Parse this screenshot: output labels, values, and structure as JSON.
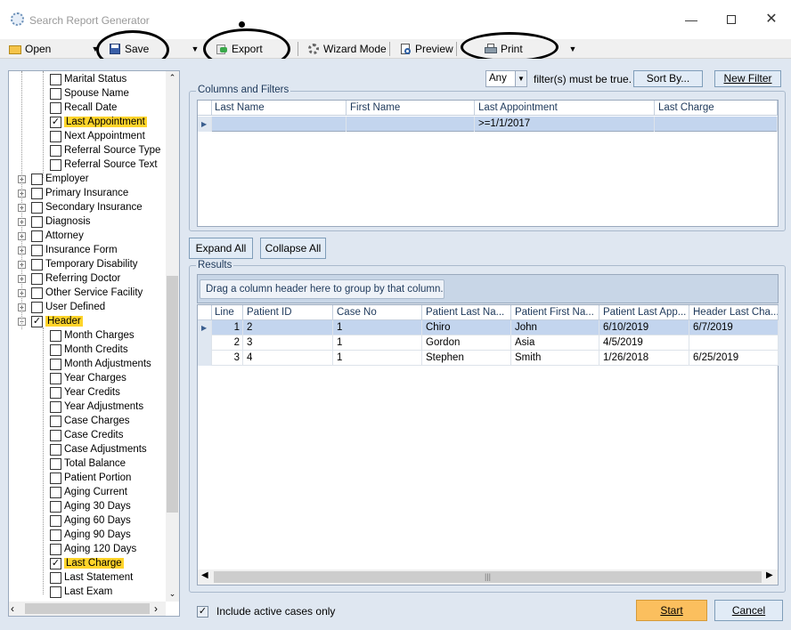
{
  "window": {
    "title": "Search Report Generator"
  },
  "toolbar": {
    "open": "Open",
    "save": "Save",
    "export": "Export",
    "wizard": "Wizard Mode",
    "preview": "Preview",
    "print": "Print"
  },
  "tree": {
    "items": [
      {
        "label": "Marital Status",
        "checked": false,
        "highlight": false
      },
      {
        "label": "Spouse Name",
        "checked": false,
        "highlight": false
      },
      {
        "label": "Recall Date",
        "checked": false,
        "highlight": false
      },
      {
        "label": "Last Appointment",
        "checked": true,
        "highlight": true
      },
      {
        "label": "Next Appointment",
        "checked": false,
        "highlight": false
      },
      {
        "label": "Referral Source Type",
        "checked": false,
        "highlight": false
      },
      {
        "label": "Referral Source Text",
        "checked": false,
        "highlight": false
      },
      {
        "label": "Employer",
        "checked": false,
        "highlight": false
      },
      {
        "label": "Primary Insurance",
        "checked": false,
        "highlight": false
      },
      {
        "label": "Secondary Insurance",
        "checked": false,
        "highlight": false
      },
      {
        "label": "Diagnosis",
        "checked": false,
        "highlight": false
      },
      {
        "label": "Attorney",
        "checked": false,
        "highlight": false
      },
      {
        "label": "Insurance Form",
        "checked": false,
        "highlight": false
      },
      {
        "label": "Temporary Disability",
        "checked": false,
        "highlight": false
      },
      {
        "label": "Referring Doctor",
        "checked": false,
        "highlight": false
      },
      {
        "label": "Other Service Facility",
        "checked": false,
        "highlight": false
      },
      {
        "label": "User Defined",
        "checked": false,
        "highlight": false
      },
      {
        "label": "Header",
        "checked": true,
        "highlight": true
      },
      {
        "label": "Month Charges",
        "checked": false,
        "highlight": false
      },
      {
        "label": "Month Credits",
        "checked": false,
        "highlight": false
      },
      {
        "label": "Month Adjustments",
        "checked": false,
        "highlight": false
      },
      {
        "label": "Year Charges",
        "checked": false,
        "highlight": false
      },
      {
        "label": "Year Credits",
        "checked": false,
        "highlight": false
      },
      {
        "label": "Year Adjustments",
        "checked": false,
        "highlight": false
      },
      {
        "label": "Case Charges",
        "checked": false,
        "highlight": false
      },
      {
        "label": "Case Credits",
        "checked": false,
        "highlight": false
      },
      {
        "label": "Case Adjustments",
        "checked": false,
        "highlight": false
      },
      {
        "label": "Total Balance",
        "checked": false,
        "highlight": false
      },
      {
        "label": "Patient Portion",
        "checked": false,
        "highlight": false
      },
      {
        "label": "Aging Current",
        "checked": false,
        "highlight": false
      },
      {
        "label": "Aging 30 Days",
        "checked": false,
        "highlight": false
      },
      {
        "label": "Aging 60 Days",
        "checked": false,
        "highlight": false
      },
      {
        "label": "Aging 90 Days",
        "checked": false,
        "highlight": false
      },
      {
        "label": "Aging 120 Days",
        "checked": false,
        "highlight": false
      },
      {
        "label": "Last Charge",
        "checked": true,
        "highlight": true
      },
      {
        "label": "Last Statement",
        "checked": false,
        "highlight": false
      },
      {
        "label": "Last Exam",
        "checked": false,
        "highlight": false
      }
    ]
  },
  "filter": {
    "mode": "Any",
    "text": "filter(s) must be true.",
    "sort_by": "Sort By...",
    "new_filter": "New Filter"
  },
  "columns": {
    "group_label": "Columns and Filters",
    "headers": [
      "Last Name",
      "First Name",
      "Last Appointment",
      "Last Charge"
    ],
    "filter_row": [
      "",
      "",
      ">=1/1/2017",
      ""
    ]
  },
  "buttons": {
    "expand_all": "Expand All",
    "collapse_all": "Collapse All",
    "start": "Start",
    "cancel": "Cancel"
  },
  "results": {
    "group_label": "Results",
    "group_hint": "Drag a column header here to group by that column.",
    "headers": [
      "Line",
      "Patient ID",
      "Case No",
      "Patient Last Na...",
      "Patient First Na...",
      "Patient Last App...",
      "Header Last Cha..."
    ],
    "rows": [
      [
        "1",
        "2",
        "1",
        "Chiro",
        "John",
        "6/10/2019",
        "6/7/2019"
      ],
      [
        "2",
        "3",
        "1",
        "Gordon",
        "Asia",
        "4/5/2019",
        ""
      ],
      [
        "3",
        "4",
        "1",
        "Stephen",
        "Smith",
        "1/26/2018",
        "6/25/2019"
      ]
    ]
  },
  "footer": {
    "include_active": "Include active cases only",
    "include_active_checked": true
  },
  "colors": {
    "accent": "#ffd42a",
    "selected_row": "#c3d5ee",
    "panel_bg": "#dfe7f1",
    "start_btn": "#fbbf5e"
  }
}
